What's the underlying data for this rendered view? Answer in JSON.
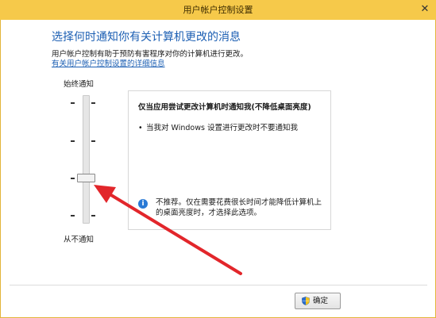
{
  "window": {
    "title": "用户帐户控制设置",
    "close_glyph": "✕"
  },
  "main": {
    "heading": "选择何时通知你有关计算机更改的消息",
    "description": "用户帐户控制有助于预防有害程序对你的计算机进行更改。",
    "more_link": "有关用户帐户控制设置的详细信息"
  },
  "slider": {
    "top_label": "始终通知",
    "bottom_label": "从不通知",
    "level": 2,
    "levels": 4
  },
  "info_box": {
    "title": "仅当应用尝试更改计算机时通知我(不降低桌面亮度)",
    "bullet": "当我对 Windows 设置进行更改时不要通知我",
    "note_icon": "info-icon",
    "note_icon_glyph": "i",
    "note": "不推荐。仅在需要花费很长时间才能降低计算机上的桌面亮度时，才选择此选项。"
  },
  "footer": {
    "ok_label": "确定",
    "ok_icon": "shield-icon"
  },
  "colors": {
    "titlebar": "#f6c94a",
    "heading": "#1c5fb3",
    "link": "#1c5fb3",
    "annotation_arrow": "#e2262b"
  }
}
